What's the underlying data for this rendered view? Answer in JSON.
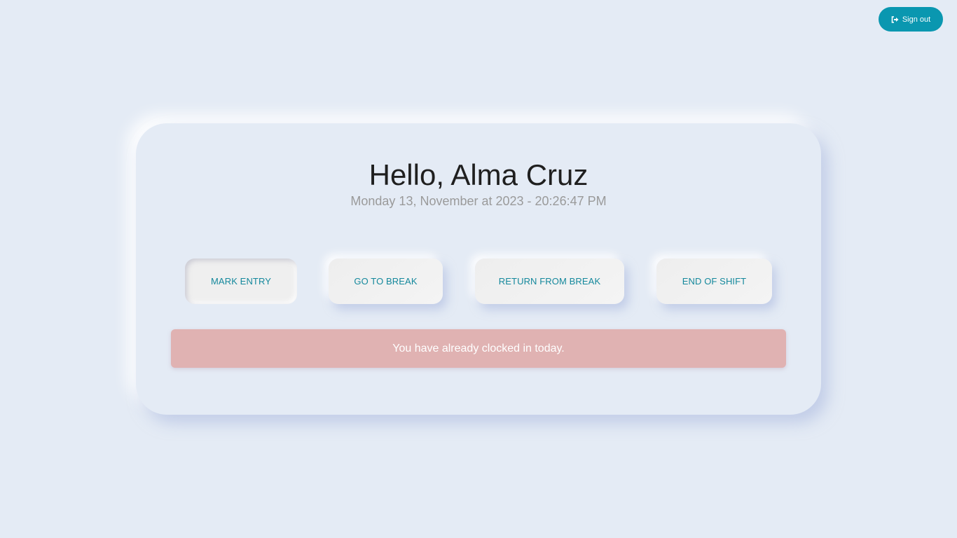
{
  "header": {
    "signout_label": "Sign out",
    "signout_icon": "sign-out-icon",
    "signout_color": "#0a97b0"
  },
  "main": {
    "greeting": "Hello, Alma Cruz",
    "datetime": "Monday 13, November at 2023 - 20:26:47 PM"
  },
  "actions": {
    "mark_entry": "MARK ENTRY",
    "go_to_break": "GO TO BREAK",
    "return_from_break": "RETURN FROM BREAK",
    "end_of_shift": "END OF SHIFT",
    "text_color": "#14889c"
  },
  "alert": {
    "message": "You have already clocked in today.",
    "background": "#e0b2b2"
  }
}
